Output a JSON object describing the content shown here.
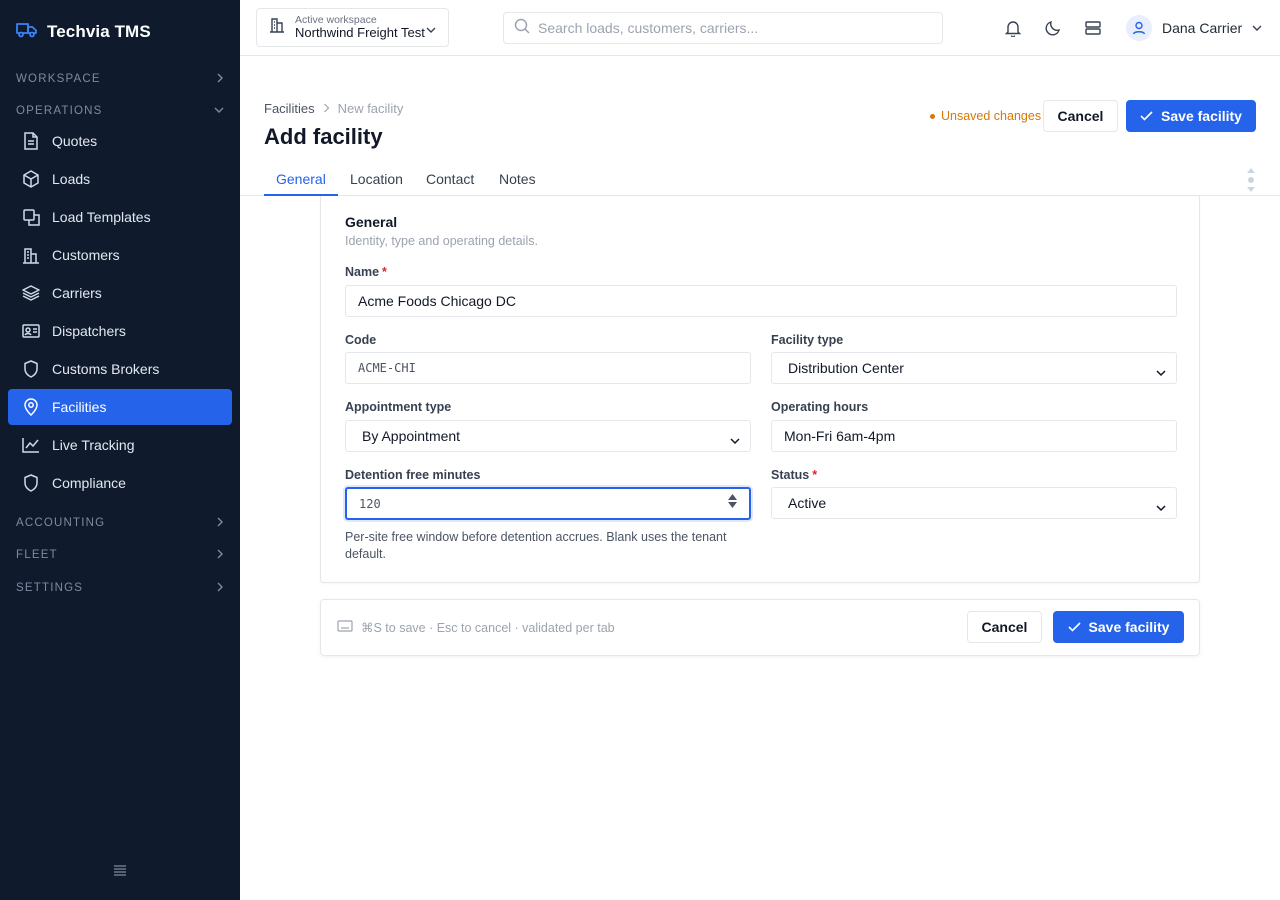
{
  "brand": {
    "name": "Techvia TMS",
    "icon": "truck-icon",
    "color": "#3b82f6"
  },
  "sidebar": {
    "sections": {
      "workspace": "WORKSPACE",
      "operations": "OPERATIONS",
      "accounting": "ACCOUNTING",
      "fleet": "FLEET",
      "settings": "SETTINGS"
    },
    "items": [
      {
        "label": "Quotes",
        "icon": "document-icon"
      },
      {
        "label": "Loads",
        "icon": "box-icon"
      },
      {
        "label": "Load Templates",
        "icon": "copy-icon"
      },
      {
        "label": "Customers",
        "icon": "building-icon"
      },
      {
        "label": "Carriers",
        "icon": "layers-icon"
      },
      {
        "label": "Dispatchers",
        "icon": "id-card-icon"
      },
      {
        "label": "Customs Brokers",
        "icon": "shield-icon"
      },
      {
        "label": "Facilities",
        "icon": "map-pin-icon",
        "active": true
      },
      {
        "label": "Live Tracking",
        "icon": "line-chart-icon"
      },
      {
        "label": "Compliance",
        "icon": "shield-icon"
      }
    ]
  },
  "topbar": {
    "workspace_label": "Active workspace",
    "workspace_value": "Northwind Freight Test",
    "search_placeholder": "Search loads, customers, carriers...",
    "user_name": "Dana Carrier"
  },
  "header": {
    "breadcrumb_root": "Facilities",
    "breadcrumb_current": "New facility",
    "title": "Add facility",
    "unsaved": "Unsaved changes",
    "cancel_label": "Cancel",
    "save_label": "Save facility"
  },
  "tabs": [
    "General",
    "Location",
    "Contact",
    "Notes"
  ],
  "form": {
    "section_title": "General",
    "section_subtitle": "Identity, type and operating details.",
    "name_label": "Name",
    "name_value": "Acme Foods Chicago DC",
    "code_label": "Code",
    "code_value": "ACME-CHI",
    "facility_type_label": "Facility type",
    "facility_type_value": "Distribution Center",
    "appointment_label": "Appointment type",
    "appointment_value": "By Appointment",
    "hours_label": "Operating hours",
    "hours_value": "Mon-Fri 6am-4pm",
    "detention_label": "Detention free minutes",
    "detention_value": "120",
    "detention_help": "Per-site free window before detention accrues. Blank uses the tenant default.",
    "status_label": "Status",
    "status_value": "Active",
    "required_mark": "*"
  },
  "footer": {
    "hint": "⌘S to save · Esc to cancel · validated per tab",
    "cancel_label": "Cancel",
    "save_label": "Save facility"
  },
  "colors": {
    "accent": "#2563eb",
    "sidebar_bg": "#0f1b2d",
    "warning": "#d97706",
    "required": "#dc2626"
  }
}
